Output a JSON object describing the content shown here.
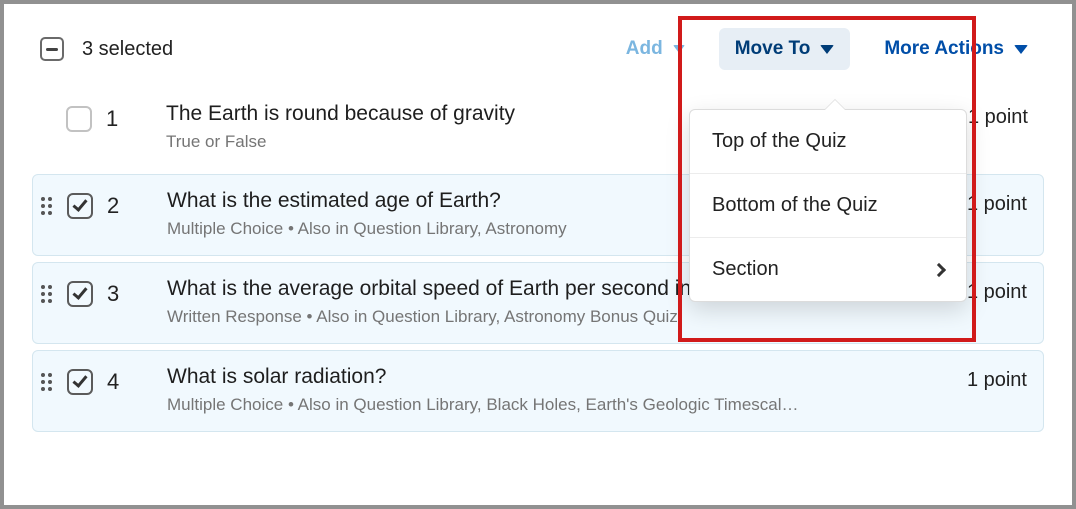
{
  "toolbar": {
    "selected_text": "3 selected",
    "add_label": "Add",
    "move_label": "Move To",
    "more_label": "More Actions"
  },
  "questions": [
    {
      "num": "1",
      "title": "The Earth is round because of gravity",
      "sub": "True or False",
      "points": "1 point",
      "selected": false
    },
    {
      "num": "2",
      "title": "What is the estimated age of Earth?",
      "sub": "Multiple Choice   •   Also in Question Library, Astronomy",
      "points": "1 point",
      "selected": true
    },
    {
      "num": "3",
      "title": "What is the average orbital speed of Earth per second in kilometers?",
      "sub": "Written Response   •   Also in Question Library, Astronomy Bonus Quiz",
      "points": "1 point",
      "selected": true
    },
    {
      "num": "4",
      "title": "What is solar radiation?",
      "sub": "Multiple Choice   •   Also in Question Library, Black Holes, Earth's Geologic Timescal…",
      "points": "1 point",
      "selected": true
    }
  ],
  "popover": {
    "top": "Top of the Quiz",
    "bottom": "Bottom of the Quiz",
    "section": "Section"
  }
}
